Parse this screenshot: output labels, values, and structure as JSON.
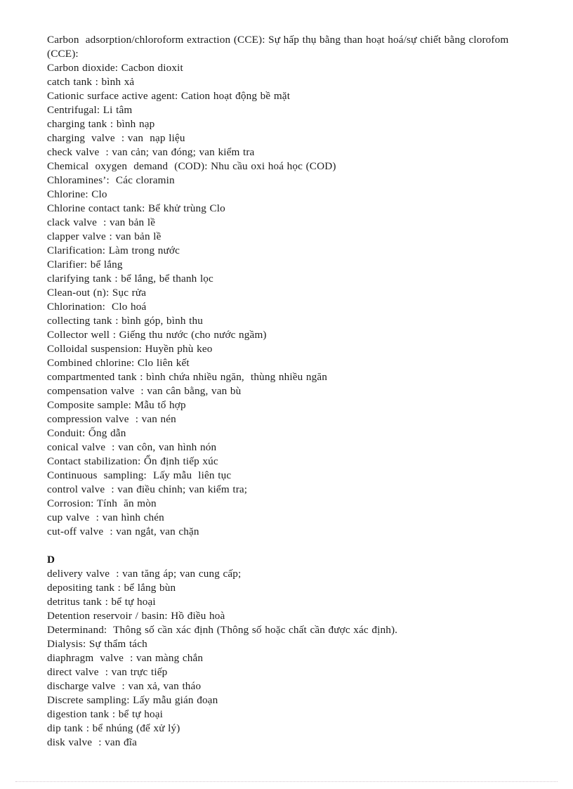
{
  "document": {
    "kind": "scanned-glossary-page",
    "language_pair": "English - Vietnamese",
    "text_color": "#1c1c1c",
    "background_color": "#ffffff"
  },
  "entries": [
    {
      "id": "cce",
      "text": "Carbon  adsorption/chloroform extraction (CCE): Sự hấp thụ bằng than hoạt hoá/sự chiết bằng clorofom (CCE):",
      "wrap": true
    },
    {
      "id": "carbon-dioxide",
      "text": "Carbon dioxide: Cacbon dioxit"
    },
    {
      "id": "catch-tank",
      "text": "catch tank : bình xả"
    },
    {
      "id": "cationic-surface-active-agent",
      "text": "Cationic surface active agent: Cation hoạt động bề mặt"
    },
    {
      "id": "centrifugal",
      "text": "Centrifugal: Li tâm"
    },
    {
      "id": "charging-tank",
      "text": "charging tank : bình nạp"
    },
    {
      "id": "charging-valve",
      "text": "charging  valve  : van  nạp liệu"
    },
    {
      "id": "check-valve",
      "text": "check valve  : van cản; van đóng; van kiểm tra"
    },
    {
      "id": "chemical-oxygen-demand",
      "text": "Chemical  oxygen  demand  (COD): Nhu cầu oxi hoá học (COD)"
    },
    {
      "id": "chloramines",
      "text": "Chloramines’:  Các cloramin"
    },
    {
      "id": "chlorine",
      "text": "Chlorine: Clo"
    },
    {
      "id": "chlorine-contact-tank",
      "text": "Chlorine contact tank: Bể khử trùng Clo"
    },
    {
      "id": "clack-valve",
      "text": "clack valve  : van bản lề"
    },
    {
      "id": "clapper-valve",
      "text": "clapper valve : van bản lề"
    },
    {
      "id": "clarification",
      "text": "Clarification: Làm trong nước"
    },
    {
      "id": "clarifier",
      "text": "Clarifier: bể lắng"
    },
    {
      "id": "clarifying-tank",
      "text": "clarifying tank : bể lắng, bể thanh lọc"
    },
    {
      "id": "clean-out",
      "text": "Clean-out (n): Sục rửa"
    },
    {
      "id": "chlorination",
      "text": "Chlorination:  Clo hoá"
    },
    {
      "id": "collecting-tank",
      "text": "collecting tank : bình góp, bình thu"
    },
    {
      "id": "collector-well",
      "text": "Collector well : Giếng thu nước (cho nước ngầm)"
    },
    {
      "id": "colloidal-suspension",
      "text": "Colloidal suspension: Huyền phù keo"
    },
    {
      "id": "combined-chlorine",
      "text": "Combined chlorine: Clo liên kết"
    },
    {
      "id": "compartmented-tank",
      "text": "compartmented tank : bình chứa nhiều ngăn,  thùng nhiều ngăn"
    },
    {
      "id": "compensation-valve",
      "text": "compensation valve  : van cân bằng, van bù"
    },
    {
      "id": "composite-sample",
      "text": "Composite sample: Mẫu tổ hợp"
    },
    {
      "id": "compression-valve",
      "text": "compression valve  : van nén"
    },
    {
      "id": "conduit",
      "text": "Conduit: Ống dẫn"
    },
    {
      "id": "conical-valve",
      "text": "conical valve  : van côn, van hình nón"
    },
    {
      "id": "contact-stabilization",
      "text": "Contact stabilization: Ổn định tiếp xúc"
    },
    {
      "id": "continuous-sampling",
      "text": "Continuous  sampling:  Lấy mẫu  liên tục"
    },
    {
      "id": "control-valve",
      "text": "control valve  : van điều chỉnh; van kiểm tra;"
    },
    {
      "id": "corrosion",
      "text": "Corrosion: Tính  ăn mòn"
    },
    {
      "id": "cup-valve",
      "text": "cup valve  : van hình chén"
    },
    {
      "id": "cut-off-valve",
      "text": "cut-off valve  : van ngắt, van chặn"
    },
    {
      "id": "spacer-1",
      "text": "",
      "blank": true
    },
    {
      "id": "section-d",
      "text": "D",
      "heading": true
    },
    {
      "id": "delivery-valve",
      "text": "delivery valve  : van tăng áp; van cung cấp;"
    },
    {
      "id": "depositing-tank",
      "text": "depositing tank : bể lắng bùn"
    },
    {
      "id": "detritus-tank",
      "text": "detritus tank : bể tự hoại"
    },
    {
      "id": "detention-reservoir",
      "text": "Detention reservoir / basin: Hồ điều hoà"
    },
    {
      "id": "determinand",
      "text": "Determinand:  Thông số cần xác định (Thông số hoặc chất cần được xác định)."
    },
    {
      "id": "dialysis",
      "text": "Dialysis: Sự thẩm tách"
    },
    {
      "id": "diaphragm-valve",
      "text": "diaphragm  valve  : van màng chắn"
    },
    {
      "id": "direct-valve",
      "text": "direct valve  : van trực tiếp"
    },
    {
      "id": "discharge-valve",
      "text": "discharge valve  : van xả, van tháo"
    },
    {
      "id": "discrete-sampling",
      "text": "Discrete sampling: Lấy mẫu gián đoạn"
    },
    {
      "id": "digestion-tank",
      "text": "digestion tank : bể tự hoại"
    },
    {
      "id": "dip-tank",
      "text": "dip tank : bể nhúng (để xử lý)"
    },
    {
      "id": "disk-valve",
      "text": "disk valve  : van đĩa"
    }
  ],
  "footer": {
    "rule_style": "dotted",
    "rule_color": "#c8b9c4"
  }
}
